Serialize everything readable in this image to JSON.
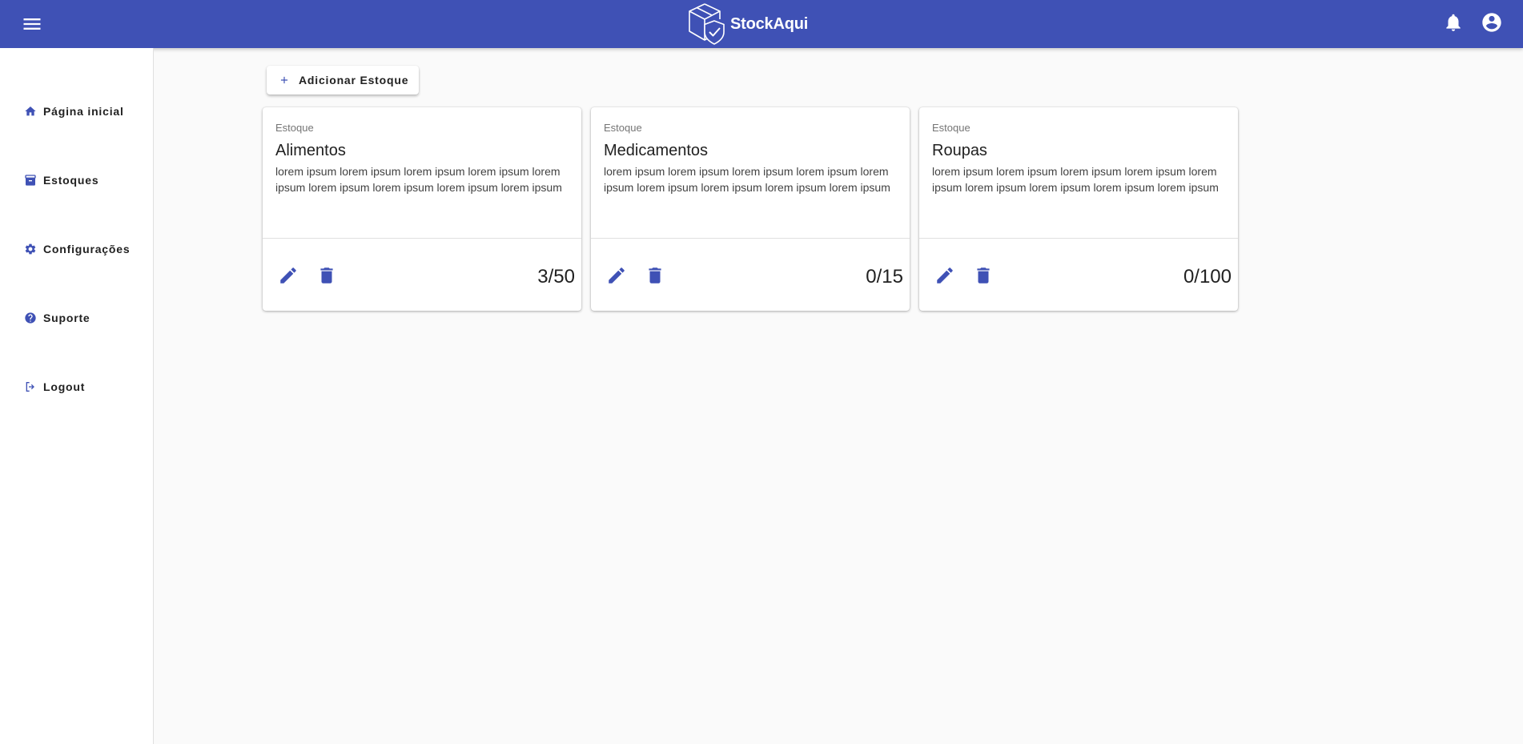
{
  "header": {
    "brand_name": "StockAqui",
    "icons": {
      "menu": "menu-icon",
      "logo": "box-shield-logo",
      "notifications": "bell-icon",
      "account": "account-circle-icon"
    },
    "color": "#3f51b5"
  },
  "sidebar": {
    "items": [
      {
        "label": "Página inicial",
        "icon": "home-icon"
      },
      {
        "label": "Estoques",
        "icon": "archive-icon"
      },
      {
        "label": "Configurações",
        "icon": "gear-icon"
      },
      {
        "label": "Suporte",
        "icon": "help-circle-icon"
      },
      {
        "label": "Logout",
        "icon": "logout-icon"
      }
    ]
  },
  "main": {
    "add_button_label": "Adicionar Estoque",
    "add_button_icon": "plus-icon",
    "cards": [
      {
        "overline": "Estoque",
        "title": "Alimentos",
        "description": "lorem ipsum lorem ipsum lorem ipsum lorem ipsum lorem ipsum lorem ipsum lorem ipsum lorem ipsum lorem ipsum",
        "count": "3/50"
      },
      {
        "overline": "Estoque",
        "title": "Medicamentos",
        "description": "lorem ipsum lorem ipsum lorem ipsum lorem ipsum lorem ipsum lorem ipsum lorem ipsum lorem ipsum lorem ipsum",
        "count": "0/15"
      },
      {
        "overline": "Estoque",
        "title": "Roupas",
        "description": "lorem ipsum lorem ipsum lorem ipsum lorem ipsum lorem ipsum lorem ipsum lorem ipsum lorem ipsum lorem ipsum",
        "count": "0/100"
      }
    ],
    "accent_color": "#3f51b5"
  }
}
